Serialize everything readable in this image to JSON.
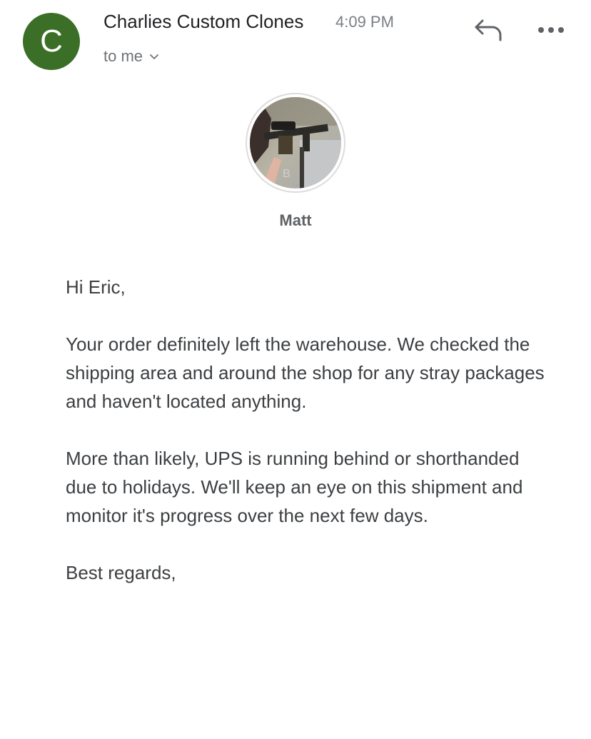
{
  "email": {
    "sender_initial": "C",
    "sender_name": "Charlies Custom Clones",
    "time": "4:09 PM",
    "recipient": "to me",
    "avatar_color": "#3b6e26"
  },
  "profile": {
    "name": "Matt"
  },
  "body": {
    "greeting": "Hi Eric,",
    "paragraph1": "Your order definitely left the warehouse. We checked the shipping area and around the shop for any stray packages and haven't located anything.",
    "paragraph2": "More than likely, UPS is running behind or shorthanded due to holidays. We'll keep an eye on this shipment and monitor it's progress over the next few days.",
    "closing": "Best regards,"
  },
  "icons": {
    "reply": "reply-icon",
    "more": "more-options-icon",
    "chevron": "chevron-down-icon"
  }
}
